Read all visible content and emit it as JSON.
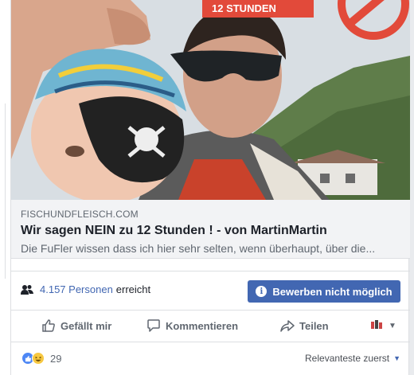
{
  "post_image": {
    "alt": "",
    "sign_text": "12 STUNDEN"
  },
  "link_preview": {
    "domain": "FISCHUNDFLEISCH.COM",
    "title": "Wir sagen NEIN zu 12 Stunden ! - von MartinMartin",
    "description": "Die FuFler wissen dass ich hier sehr selten, wenn überhaupt, über die..."
  },
  "reach": {
    "count": "4.157 Personen",
    "suffix": "erreicht",
    "icon": "people-icon"
  },
  "boost_button": {
    "label": "Bewerben nicht möglich",
    "icon": "info-icon",
    "color": "#4267b2"
  },
  "actions": {
    "like_label": "Gefällt mir",
    "comment_label": "Kommentieren",
    "share_label": "Teilen"
  },
  "reactions": {
    "count": "29",
    "icons": [
      "like-reaction-icon",
      "haha-reaction-icon"
    ]
  },
  "sort": {
    "label": "Relevanteste zuerst"
  }
}
